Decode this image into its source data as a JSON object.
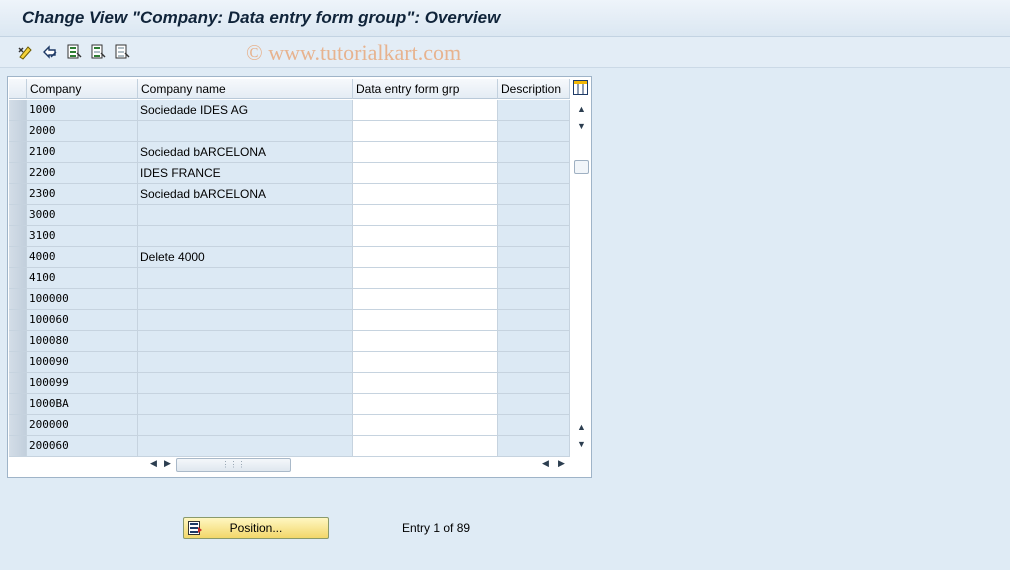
{
  "window": {
    "title": "Change View \"Company: Data entry form group\": Overview"
  },
  "toolbar": {
    "icons": [
      "display-change-icon",
      "undo-icon",
      "select-all-icon",
      "select-block-icon",
      "deselect-all-icon"
    ]
  },
  "watermark": "© www.tutorialkart.com",
  "table": {
    "columns": [
      "Company",
      "Company name",
      "Data entry form grp",
      "Description"
    ],
    "rows": [
      {
        "code": "1000",
        "name": "Sociedade IDES AG",
        "grp": "",
        "desc": ""
      },
      {
        "code": "2000",
        "name": "",
        "grp": "",
        "desc": ""
      },
      {
        "code": "2100",
        "name": "Sociedad bARCELONA",
        "grp": "",
        "desc": ""
      },
      {
        "code": "2200",
        "name": "IDES FRANCE",
        "grp": "",
        "desc": ""
      },
      {
        "code": "2300",
        "name": "Sociedad bARCELONA",
        "grp": "",
        "desc": ""
      },
      {
        "code": "3000",
        "name": "",
        "grp": "",
        "desc": ""
      },
      {
        "code": "3100",
        "name": "",
        "grp": "",
        "desc": ""
      },
      {
        "code": "4000",
        "name": "Delete 4000",
        "grp": "",
        "desc": ""
      },
      {
        "code": "4100",
        "name": "",
        "grp": "",
        "desc": ""
      },
      {
        "code": "100000",
        "name": "",
        "grp": "",
        "desc": ""
      },
      {
        "code": "100060",
        "name": "",
        "grp": "",
        "desc": ""
      },
      {
        "code": "100080",
        "name": "",
        "grp": "",
        "desc": ""
      },
      {
        "code": "100090",
        "name": "",
        "grp": "",
        "desc": ""
      },
      {
        "code": "100099",
        "name": "",
        "grp": "",
        "desc": ""
      },
      {
        "code": "1000BA",
        "name": "",
        "grp": "",
        "desc": ""
      },
      {
        "code": "200000",
        "name": "",
        "grp": "",
        "desc": ""
      },
      {
        "code": "200060",
        "name": "",
        "grp": "",
        "desc": ""
      }
    ]
  },
  "footer": {
    "position_label": "Position...",
    "entry_text": "Entry 1 of 89"
  },
  "colors": {
    "accent_button": "#f2d76a",
    "table_readonly_bg": "#dce9f4",
    "watermark": "#e7b38f"
  }
}
